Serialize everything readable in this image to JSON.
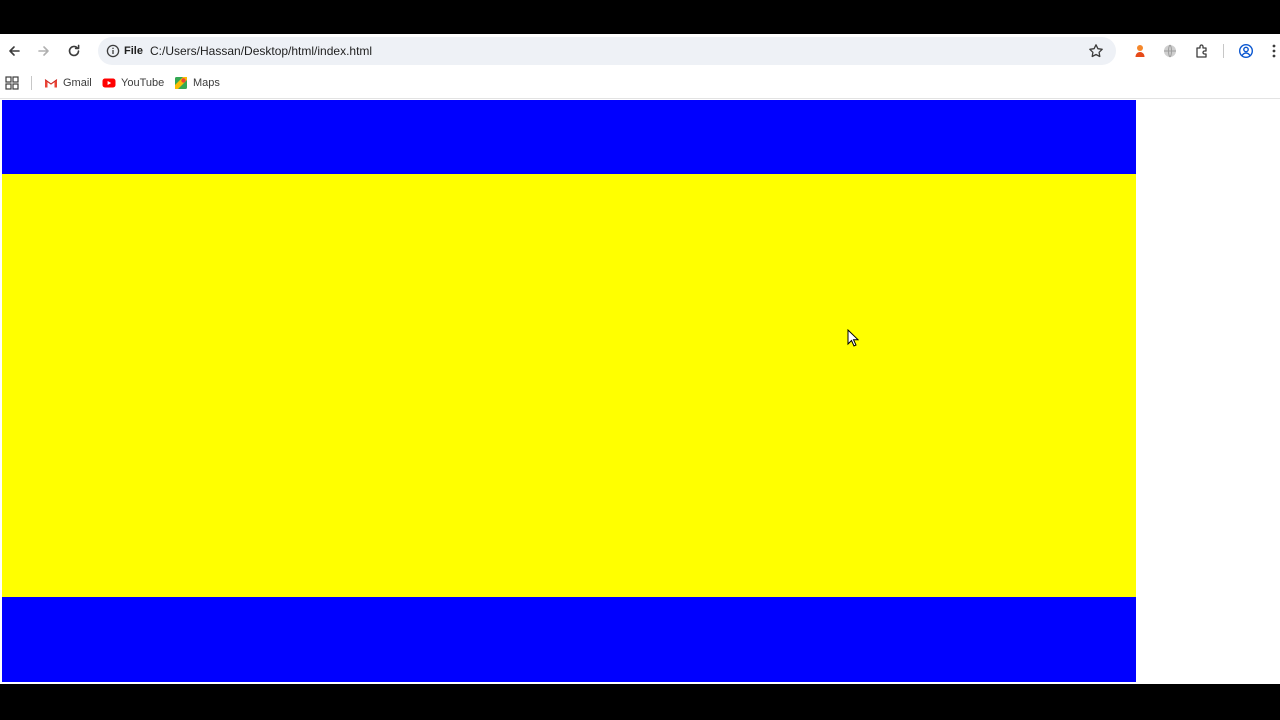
{
  "browser": {
    "address_bar": {
      "site_chip_label": "File",
      "url": "C:/Users/Hassan/Desktop/html/index.html"
    },
    "bookmarks": [
      {
        "label": "Gmail",
        "icon": "gmail-icon"
      },
      {
        "label": "YouTube",
        "icon": "youtube-icon"
      },
      {
        "label": "Maps",
        "icon": "maps-icon"
      }
    ],
    "toolbar_icons": [
      "back-icon",
      "forward-icon",
      "reload-icon",
      "star-icon",
      "extension-icon",
      "globe-icon",
      "puzzle-icon",
      "profile-icon",
      "menu-icon"
    ]
  },
  "page": {
    "bands": [
      {
        "name": "top",
        "color": "#0000ff"
      },
      {
        "name": "middle",
        "color": "#ffff00"
      },
      {
        "name": "bottom",
        "color": "#0000ff"
      }
    ]
  }
}
